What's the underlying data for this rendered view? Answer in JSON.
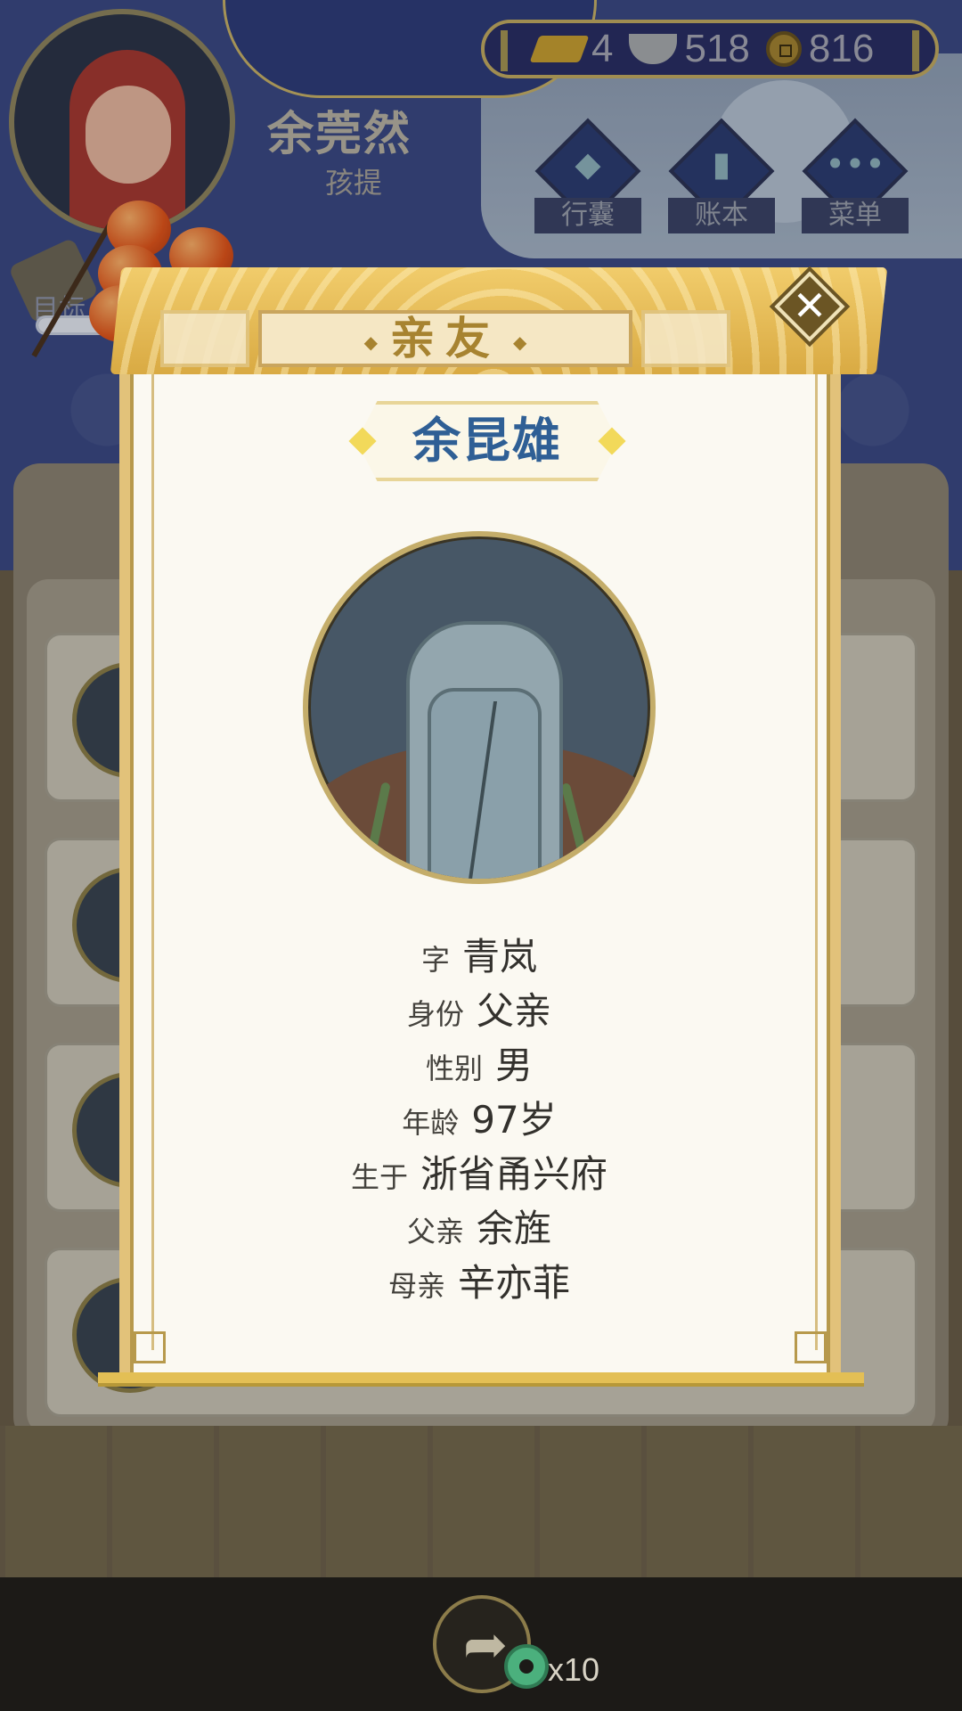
{
  "player": {
    "name": "余莞然",
    "title": "孩提"
  },
  "currency": {
    "gold": "4",
    "silver": "518",
    "copper": "816"
  },
  "menu": {
    "items": [
      {
        "label": "行囊",
        "glyph": "🎒",
        "icon": "bag-icon"
      },
      {
        "label": "账本",
        "glyph": "▮",
        "icon": "ledger-icon"
      },
      {
        "label": "菜单",
        "glyph": "•••",
        "icon": "more-icon"
      }
    ]
  },
  "goal": {
    "label": "目标",
    "progress": 1.0
  },
  "dialog": {
    "title": "亲友",
    "close_glyph": "✕",
    "relative": {
      "name": "余昆雄",
      "portrait": "tombstone",
      "fields": [
        {
          "label": "字",
          "value": "青岚"
        },
        {
          "label": "身份",
          "value": "父亲"
        },
        {
          "label": "性别",
          "value": "男"
        },
        {
          "label": "年龄",
          "value": "97岁"
        },
        {
          "label": "生于",
          "value": "浙省甬兴府"
        },
        {
          "label": "父亲",
          "value": "余旌"
        },
        {
          "label": "母亲",
          "value": "辛亦菲"
        }
      ]
    }
  },
  "share": {
    "count_text": "x10",
    "icon": "share-icon",
    "reward_icon": "jade-coin-icon"
  },
  "colors": {
    "accent_gold": "#e2c27a",
    "name_blue": "#2f5f95",
    "title_gold": "#a78330",
    "background_blue": "#34407f"
  }
}
